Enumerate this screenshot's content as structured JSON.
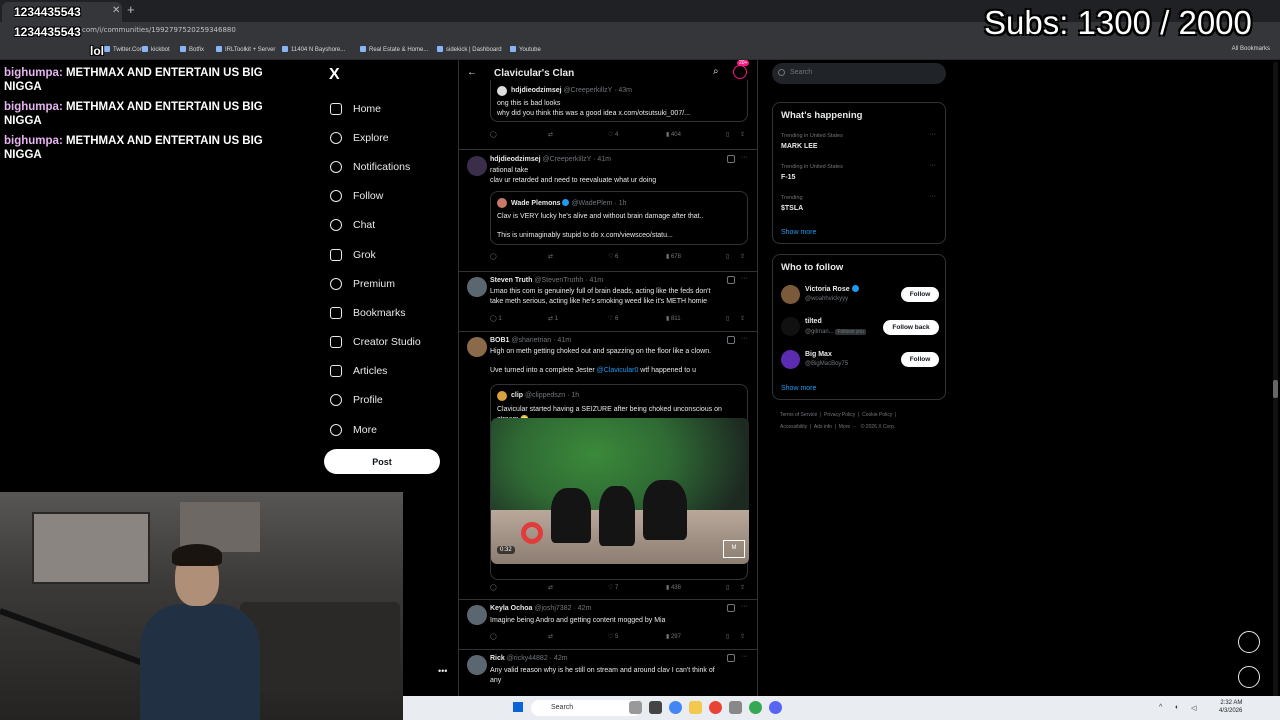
{
  "browser": {
    "address": "com/i/communities/1992797520259346880",
    "bookmarks": [
      "Twitter.Com",
      "kickbot",
      "Botfix",
      "IRLToolkit + Server",
      "11404 N Bayshore...",
      "Real Estate & Home...",
      "sidekick | Dashboard",
      "Youtube"
    ],
    "all_bookmarks": "All Bookmarks"
  },
  "overlay": {
    "id1": "1234435543",
    "id2": "1234435543",
    "lol": "lol",
    "subs": "Subs: 1300 / 2000",
    "chat": [
      {
        "user": "bighumpa:",
        "text": " METHMAX AND ENTERTAIN US BIG NIGGA"
      },
      {
        "user": "bighumpa:",
        "text": " METHMAX AND ENTERTAIN US BIG NIGGA"
      },
      {
        "user": "bighumpa:",
        "text": " METHMAX AND ENTERTAIN US BIG NIGGA"
      }
    ]
  },
  "nav": {
    "logo": "X",
    "items": [
      "Home",
      "Explore",
      "Notifications",
      "Follow",
      "Chat",
      "Grok",
      "Premium",
      "Bookmarks",
      "Creator Studio",
      "Articles",
      "Profile",
      "More"
    ],
    "post": "Post",
    "more_dots": "•••"
  },
  "column": {
    "title": "Clavicular's Clan",
    "badge": "20+",
    "top_quote": {
      "name": "hdjdieodzimsej",
      "handle": "@CreeperkillzY · 43m",
      "line1": "ong this is bad looks",
      "line2": "why did you think this was a good idea x.com/otsutsuki_007/..."
    },
    "top_actions": [
      "",
      "",
      "4",
      "404"
    ],
    "tweets": [
      {
        "name": "hdjdieodzimsej",
        "handle": "@CreeperkillzY · 41m",
        "lines": [
          "rational take",
          "clav ur retarded and need to reevaluate what ur doing"
        ],
        "quote": {
          "name": "Wade Plemons",
          "handle": "@WadePlem · 1h",
          "line1": "Clav is VERY lucky he's alive and without brain damage after that..",
          "line2": "This is unimaginably stupid to do x.com/viewsceo/statu..."
        },
        "actions": [
          "",
          "",
          "6",
          "678"
        ]
      },
      {
        "name": "Steven Truth",
        "handle": "@StevenTruthh · 41m",
        "lines": [
          "Lmao this com is genuinely full of brain deads, acting like the feds don't",
          "take meth serious, acting like he's smoking weed like it's METH homie"
        ],
        "actions": [
          "1",
          "1",
          "6",
          "811"
        ]
      },
      {
        "name": "BOB1",
        "handle": "@shanetrian · 41m",
        "lines": [
          "High on meth getting choked out and spazzing on the floor like a clown."
        ],
        "line3_pre": "Uve turned into a complete Jester ",
        "line3_link": "@Clavicular0",
        "line3_post": " wtf happened to u",
        "quote": {
          "name": "clip",
          "handle": "@clippedszn · 1h",
          "line1": "Clavicular started having a SEIZURE after being choked unconscious on",
          "line2": "stream 😳"
        },
        "video_time": "0:32",
        "actions": [
          "",
          "",
          "7",
          "438"
        ]
      },
      {
        "name": "Keyla Ochoa",
        "handle": "@joshj7382 · 42m",
        "lines": [
          "Imagine being Andro and getting content mogged by Mia"
        ],
        "actions": [
          "",
          "",
          "5",
          "297"
        ]
      },
      {
        "name": "Rick",
        "handle": "@ricky44882 · 42m",
        "lines": [
          "Any valid reason why is he still on stream and around clav  I can't think of",
          "any"
        ]
      }
    ]
  },
  "right": {
    "search_placeholder": "Search",
    "happening_title": "What's happening",
    "trends": [
      {
        "context": "Trending in United States",
        "name": "MARK LEE"
      },
      {
        "context": "Trending in United States",
        "name": "F-15"
      },
      {
        "context": "Trending",
        "name": "$TSLA"
      }
    ],
    "show_more": "Show more",
    "wtf_title": "Who to follow",
    "follow_suggestions": [
      {
        "name": "Victoria Rose",
        "handle": "@woahhvickyyy",
        "button": "Follow"
      },
      {
        "name": "tilted",
        "handle": "@gilman...",
        "badge": "Follows you",
        "button": "Follow back"
      },
      {
        "name": "Big Max",
        "handle": "@BigMacBoy75",
        "button": "Follow"
      }
    ],
    "footer1": [
      "Terms of Service",
      "Privacy Policy",
      "Cookie Policy"
    ],
    "footer2": [
      "Accessibility",
      "Ads info",
      "More ···",
      "© 2026 X Corp."
    ]
  },
  "taskbar": {
    "search": "Search",
    "time": "2:32 AM",
    "date": "4/3/2026"
  },
  "colors": {
    "accent": "#1d9bf0",
    "bg": "#000000",
    "text": "#e7e9ea",
    "muted": "#71767b"
  }
}
